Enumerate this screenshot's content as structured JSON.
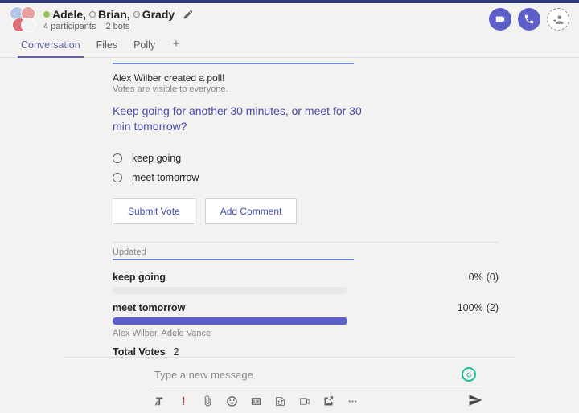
{
  "header": {
    "participants": [
      {
        "name": "Adele,",
        "presence": "available"
      },
      {
        "name": "Brian,",
        "presence": "offline"
      },
      {
        "name": "Grady",
        "presence": "offline"
      }
    ],
    "participants_label": "4 participants",
    "bots_label": "2 bots"
  },
  "tabs": {
    "items": [
      "Conversation",
      "Files",
      "Polly"
    ],
    "active_index": 0
  },
  "poll": {
    "header_line": "Alex Wilber created a poll!",
    "visibility_line": "Votes are visible to everyone.",
    "question": "Keep going for another 30 minutes, or meet for 30 min tomorrow?",
    "options": [
      "keep going",
      "meet tomorrow"
    ],
    "submit_label": "Submit Vote",
    "comment_label": "Add Comment"
  },
  "results": {
    "updated_label": "Updated",
    "items": [
      {
        "label": "keep going",
        "pct_text": "0%",
        "count_text": "(0)",
        "pct": 0,
        "voters": ""
      },
      {
        "label": "meet tomorrow",
        "pct_text": "100%",
        "count_text": "(2)",
        "pct": 100,
        "voters": "Alex Wilber, Adele Vance"
      }
    ],
    "total_label": "Total Votes",
    "total_value": "2"
  },
  "compose": {
    "placeholder": "Type a new message"
  }
}
